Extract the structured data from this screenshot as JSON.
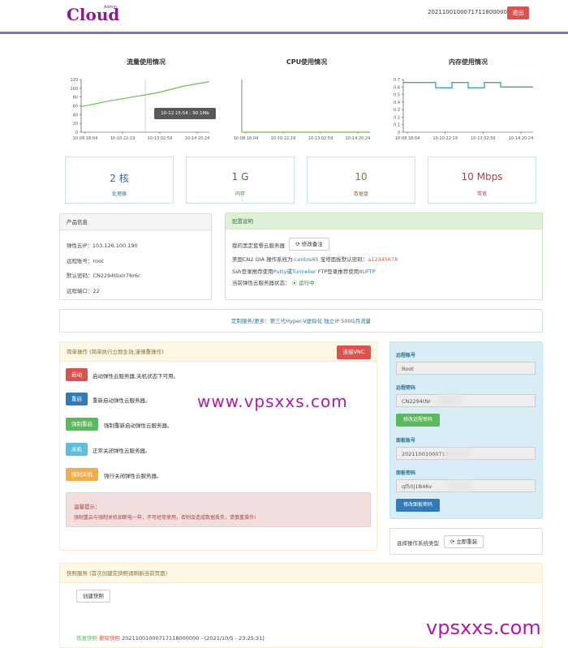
{
  "header": {
    "logo": "Cloud",
    "logo_sup": "Admin",
    "user_id": "20211001000717118000000",
    "logout": "退出"
  },
  "charts": {
    "traffic": {
      "title": "流量使用情况",
      "tooltip": "10-12 15:54 : 90.1Mb"
    },
    "cpu": {
      "title": "CPU使用情况"
    },
    "memory": {
      "title": "内存使用情况"
    }
  },
  "chart_data": [
    {
      "type": "line",
      "title": "流量使用情况",
      "x": [
        "10-08 18:04",
        "10-10 22:19",
        "10-13 02:59",
        "10-14 20:24"
      ],
      "y_ticks": [
        "0",
        "20",
        "40",
        "60",
        "80",
        "100",
        "120"
      ],
      "ylim": [
        0,
        120
      ],
      "series": [
        {
          "values": [
            58,
            70,
            80,
            90,
            105,
            115
          ]
        }
      ]
    },
    {
      "type": "line",
      "title": "CPU使用情况",
      "x": [
        "10-08 18:04",
        "10-10 22:19",
        "10-13 02:59",
        "10-14 20:24"
      ],
      "series": [
        {
          "values": [
            0,
            0,
            0,
            0
          ]
        }
      ]
    },
    {
      "type": "line",
      "title": "内存使用情况",
      "x": [
        "10-08 18:04",
        "10-10 22:19",
        "10-13 02:59",
        "10-14 20:24"
      ],
      "y_ticks": [
        "0",
        "0.1",
        "0.2",
        "0.3",
        "0.4",
        "0.5",
        "0.6",
        "0.7"
      ],
      "ylim": [
        0,
        0.7
      ],
      "series": [
        {
          "values": [
            0.66,
            0.66,
            0.59,
            0.66,
            0.59,
            0.66,
            0.6,
            0.6,
            0.6
          ]
        }
      ]
    }
  ],
  "stats": [
    {
      "value": "2 核",
      "label": "处理器",
      "color": "#31708f"
    },
    {
      "value": "1 G",
      "label": "内存",
      "color": "#3c763d"
    },
    {
      "value": "10",
      "label": "数据盘",
      "color": "#8a6d3b"
    },
    {
      "value": "10 Mbps",
      "label": "带宽",
      "color": "#a94442"
    }
  ],
  "product": {
    "title": "产品信息",
    "ip": "弹性云IP：103.126.100.190",
    "account": "远程账号：root",
    "password": "默认密码：CN2294tlixir76r6r",
    "port": "远程端口：22"
  },
  "config": {
    "title": "配置说明",
    "line1": "我的黑定套餐云服务器",
    "edit_note": "修改备注",
    "line2a": "美国CN2 GIA 操作系统为:",
    "os": "centos65",
    "line2b": " 宝塔面板默认密码：",
    "panel_pwd": "a12345678",
    "line3a": "Ssh登录推荐使用",
    "putty": "Putty",
    "or": "或",
    "tunnelier": "Tunnelier",
    "line3b": " FTP登录推荐使用",
    "ftp": "8UFTP",
    "status_label": "当前弹性云服务器状态：",
    "status": "运行中"
  },
  "custom": {
    "text": "定制服务/更多：第三代Hyper-V虚拟化 独立IP 500G月流量"
  },
  "ops": {
    "title": "简单操作 (简单执行立即生效,谨慎重操作)",
    "vnc": "连接VNC",
    "items": [
      {
        "btn": "启动",
        "desc": "启动弹性云服务器,关机状态下可用。",
        "color": "#d9534f"
      },
      {
        "btn": "重启",
        "desc": "重新启动弹性云服务器。",
        "color": "#337ab7"
      },
      {
        "btn": "强制重启",
        "desc": "强制重新启动弹性云服务器。",
        "color": "#5cb85c"
      },
      {
        "btn": "关机",
        "desc": "正常关闭弹性云服务器。",
        "color": "#5bc0de"
      },
      {
        "btn": "强制关机",
        "desc": "强行关闭弹性云服务器。",
        "color": "#f0ad4e"
      }
    ],
    "warn_title": "温馨提示：",
    "warn_text": "强制重启与强制关机如断电一样，不可经常使用，否则会造成数据丢失，请慎重操作!"
  },
  "watermark": {
    "center": "www.vpsxxs.com",
    "corner": "vpsxxs.com"
  },
  "remote": {
    "account_label": "远程账号",
    "account": "Root",
    "pwd_label": "远程密码",
    "pwd": "CN2294tNr",
    "pwd_btn": "修改远程密码",
    "panel_label": "面板账号",
    "panel": "20211001000717",
    "panel_pwd_label": "面板密码",
    "panel_pwd": "qf50j1B46v",
    "panel_btn": "修改面板密码"
  },
  "reinstall": {
    "label": "选择操作系统类型",
    "btn": "立即重装"
  },
  "snapshot": {
    "title": "快照服务 (首次创建完快照请刷新当前页面)",
    "create": "创建快照",
    "restore": "恢复快照",
    "delete": "删除快照",
    "entry": "20211001000717118000000 - (2021/10/5 - 23:25:31)"
  }
}
